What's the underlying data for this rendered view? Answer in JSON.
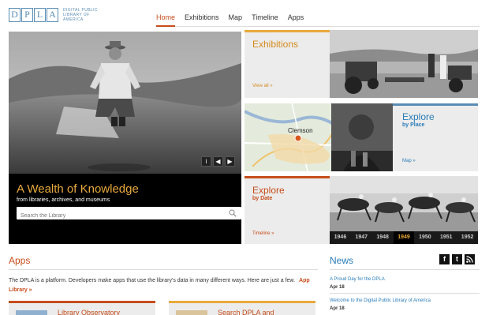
{
  "logo": {
    "letters": [
      "D",
      "P",
      "L",
      "A"
    ],
    "text": "Digital Public Library of America"
  },
  "nav": {
    "items": [
      "Home",
      "Exhibitions",
      "Map",
      "Timeline",
      "Apps"
    ],
    "active": "Home"
  },
  "hero": {
    "title": "A Wealth of Knowledge",
    "subtitle": "from libraries, archives, and museums",
    "search_placeholder": "Search the Library",
    "controls": [
      "i",
      "◀",
      "▶"
    ]
  },
  "tiles": {
    "exhibitions": {
      "title": "Exhibitions",
      "link": "View all »"
    },
    "place": {
      "title": "Explore",
      "subtitle": "by Place",
      "link": "Map »",
      "map_label": "Clemson"
    },
    "date": {
      "title": "Explore",
      "subtitle": "by Date",
      "link": "Timeline »"
    }
  },
  "timeline": {
    "years": [
      "1946",
      "1947",
      "1948",
      "1949",
      "1950",
      "1951",
      "1952"
    ],
    "selected": "1949"
  },
  "apps": {
    "heading": "Apps",
    "description": "The DPLA is a platform. Developers make apps that use the library's data in many different ways. Here are just a few.",
    "link": "App Library »",
    "cards": [
      "Library Observatory",
      "Search DPLA and"
    ]
  },
  "news": {
    "heading": "News",
    "social": [
      "f",
      "t",
      "rss"
    ],
    "items": [
      {
        "title": "A Proud Day for the DPLA",
        "date": "Apr 18"
      },
      {
        "title": "Welcome to the Digital Public Library of America",
        "date": "Apr 18"
      }
    ]
  },
  "colors": {
    "accent_orange": "#c64d1c",
    "accent_gold": "#e8a93c",
    "accent_blue": "#2a7cb8",
    "logo_blue": "#5a8db5"
  }
}
